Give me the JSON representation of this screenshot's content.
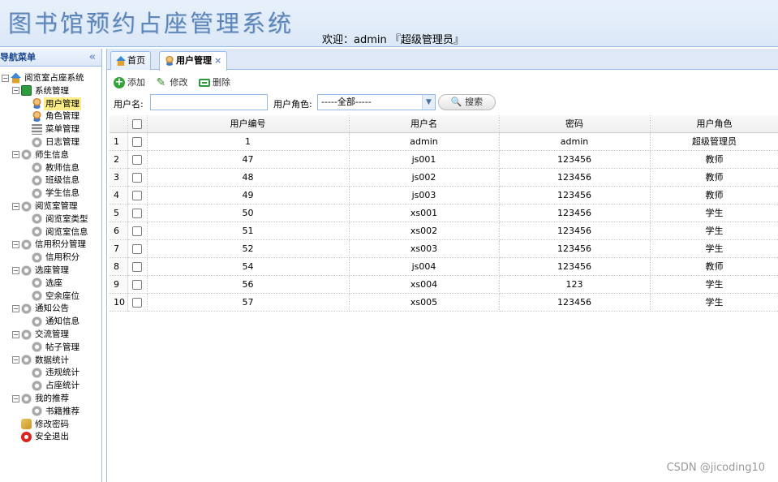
{
  "header": {
    "app_title": "图书馆预约占座管理系统",
    "welcome": "欢迎：admin 『超级管理员』"
  },
  "nav": {
    "title": "导航菜单",
    "collapse_glyph": "«",
    "tree": [
      {
        "label": "阅览室占座系统",
        "icon": "home-icon"
      },
      {
        "label": "系统管理",
        "icon": "book-icon"
      },
      {
        "label": "用户管理",
        "icon": "user-icon",
        "selected": true
      },
      {
        "label": "角色管理",
        "icon": "users-icon"
      },
      {
        "label": "菜单管理",
        "icon": "menu-icon"
      },
      {
        "label": "日志管理",
        "icon": "gear-icon"
      },
      {
        "label": "师生信息",
        "icon": "gear-icon"
      },
      {
        "label": "教师信息",
        "icon": "gear-icon"
      },
      {
        "label": "班级信息",
        "icon": "gear-icon"
      },
      {
        "label": "学生信息",
        "icon": "gear-icon"
      },
      {
        "label": "阅览室管理",
        "icon": "gear-icon"
      },
      {
        "label": "阅览室类型",
        "icon": "gear-icon"
      },
      {
        "label": "阅览室信息",
        "icon": "gear-icon"
      },
      {
        "label": "信用积分管理",
        "icon": "gear-icon"
      },
      {
        "label": "信用积分",
        "icon": "gear-icon"
      },
      {
        "label": "选座管理",
        "icon": "gear-icon"
      },
      {
        "label": "选座",
        "icon": "gear-icon"
      },
      {
        "label": "空余座位",
        "icon": "gear-icon"
      },
      {
        "label": "通知公告",
        "icon": "gear-icon"
      },
      {
        "label": "通知信息",
        "icon": "gear-icon"
      },
      {
        "label": "交流管理",
        "icon": "gear-icon"
      },
      {
        "label": "帖子管理",
        "icon": "gear-icon"
      },
      {
        "label": "数据统计",
        "icon": "gear-icon"
      },
      {
        "label": "违规统计",
        "icon": "gear-icon"
      },
      {
        "label": "占座统计",
        "icon": "gear-icon"
      },
      {
        "label": "我的推荐",
        "icon": "gear-icon"
      },
      {
        "label": "书籍推荐",
        "icon": "gear-icon"
      },
      {
        "label": "修改密码",
        "icon": "key-icon"
      },
      {
        "label": "安全退出",
        "icon": "exit-icon"
      }
    ]
  },
  "tabs": [
    {
      "label": "首页",
      "icon": "home-icon"
    },
    {
      "label": "用户管理",
      "icon": "user-icon",
      "close": "×"
    }
  ],
  "toolbar": {
    "add": "添加",
    "edit": "修改",
    "delete": "删除"
  },
  "search": {
    "username_label": "用户名:",
    "username_value": "",
    "role_label": "用户角色:",
    "role_value": "-----全部-----",
    "button": "搜索"
  },
  "grid": {
    "columns": [
      "用户编号",
      "用户名",
      "密码",
      "用户角色"
    ],
    "rows": [
      {
        "n": "1",
        "id": "1",
        "name": "admin",
        "pwd": "admin",
        "role": "超级管理员"
      },
      {
        "n": "2",
        "id": "47",
        "name": "js001",
        "pwd": "123456",
        "role": "教师"
      },
      {
        "n": "3",
        "id": "48",
        "name": "js002",
        "pwd": "123456",
        "role": "教师"
      },
      {
        "n": "4",
        "id": "49",
        "name": "js003",
        "pwd": "123456",
        "role": "教师"
      },
      {
        "n": "5",
        "id": "50",
        "name": "xs001",
        "pwd": "123456",
        "role": "学生"
      },
      {
        "n": "6",
        "id": "51",
        "name": "xs002",
        "pwd": "123456",
        "role": "学生"
      },
      {
        "n": "7",
        "id": "52",
        "name": "xs003",
        "pwd": "123456",
        "role": "学生"
      },
      {
        "n": "8",
        "id": "54",
        "name": "js004",
        "pwd": "123456",
        "role": "教师"
      },
      {
        "n": "9",
        "id": "56",
        "name": "xs004",
        "pwd": "123",
        "role": "学生"
      },
      {
        "n": "10",
        "id": "57",
        "name": "xs005",
        "pwd": "123456",
        "role": "学生"
      }
    ]
  },
  "watermark": "CSDN @jicoding10",
  "colors": {
    "header_bg": "#dbe8f7",
    "border": "#99bbe8",
    "selected_bg": "#fbec88",
    "title": "#5d86b8"
  }
}
